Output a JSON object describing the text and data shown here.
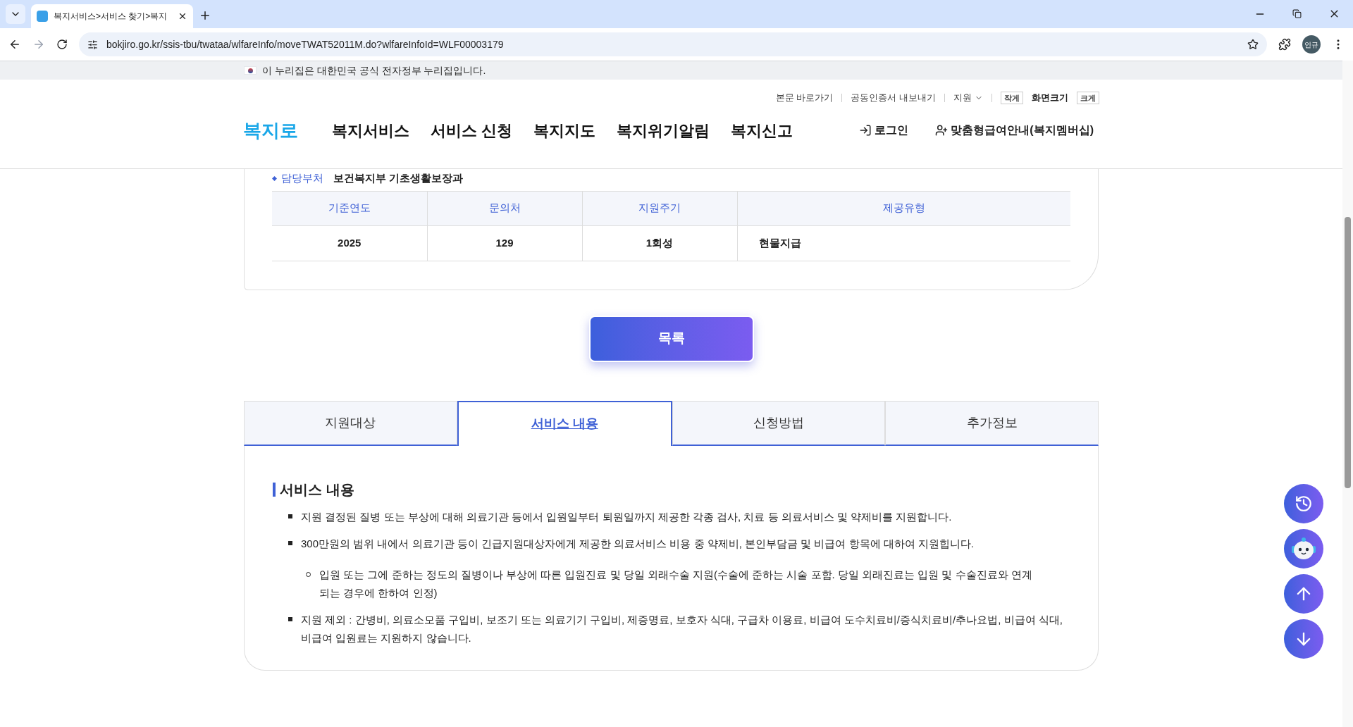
{
  "browser": {
    "tab_title": "복지서비스>서비스 찾기>복지",
    "url": "bokjiro.go.kr/ssis-tbu/twataa/wlfareInfo/moveTWAT52011M.do?wlfareInfoId=WLF00003179",
    "profile": "인규"
  },
  "gov_banner": "이 누리집은 대한민국 공식 전자정부 누리집입니다.",
  "utility_links": [
    "본문 바로가기",
    "공동인증서 내보내기"
  ],
  "language": "지원",
  "font_size": {
    "smaller": "작게",
    "label": "화면크기",
    "larger": "크게"
  },
  "logo": "복지로",
  "nav": [
    "복지서비스",
    "서비스 신청",
    "복지지도",
    "복지위기알림",
    "복지신고"
  ],
  "login": "로그인",
  "membership": "맞춤형급여안내(복지멤버십)",
  "department": {
    "label": "담당부처",
    "value": "보건복지부 기초생활보장과"
  },
  "table": {
    "columns": [
      "기준연도",
      "문의처",
      "지원주기",
      "제공유형"
    ],
    "rows": [
      [
        "2025",
        "129",
        "1회성",
        "현물지급"
      ]
    ]
  },
  "list_button": "목록",
  "tabs": [
    {
      "label": "지원대상",
      "selected": false
    },
    {
      "label": "서비스 내용",
      "selected": true
    },
    {
      "label": "신청방법",
      "selected": false
    },
    {
      "label": "추가정보",
      "selected": false
    }
  ],
  "section": {
    "title": "서비스 내용",
    "items": [
      {
        "text": "지원 결정된 질병 또는 부상에 대해 의료기관 등에서 입원일부터 퇴원일까지 제공한 각종 검사, 치료 등 의료서비스 및 약제비를 지원합니다."
      },
      {
        "text": "300만원의 범위 내에서 의료기관 등이 긴급지원대상자에게 제공한 의료서비스 비용 중 약제비, 본인부담금 및 비급여 항목에 대하여 지원힙니다.",
        "children": [
          {
            "text": "입원 또는 그에 준하는 정도의 질병이나 부상에 따른 입원진료 및 당일 외래수술 지원(수술에 준하는 시술 포함. 당일 외래진료는 입원 및 수술진료와 연계되는 경우에 한하여 인정)"
          }
        ]
      },
      {
        "text": "지원 제외 : 간병비, 의료소모품 구입비, 보조기 또는 의료기기 구입비, 제증명료, 보호자 식대, 구급차 이용료, 비급여 도수치료비/증식치료비/추나요법, 비급여 식대, 비급여 입원료는 지원하지 않습니다."
      }
    ]
  }
}
